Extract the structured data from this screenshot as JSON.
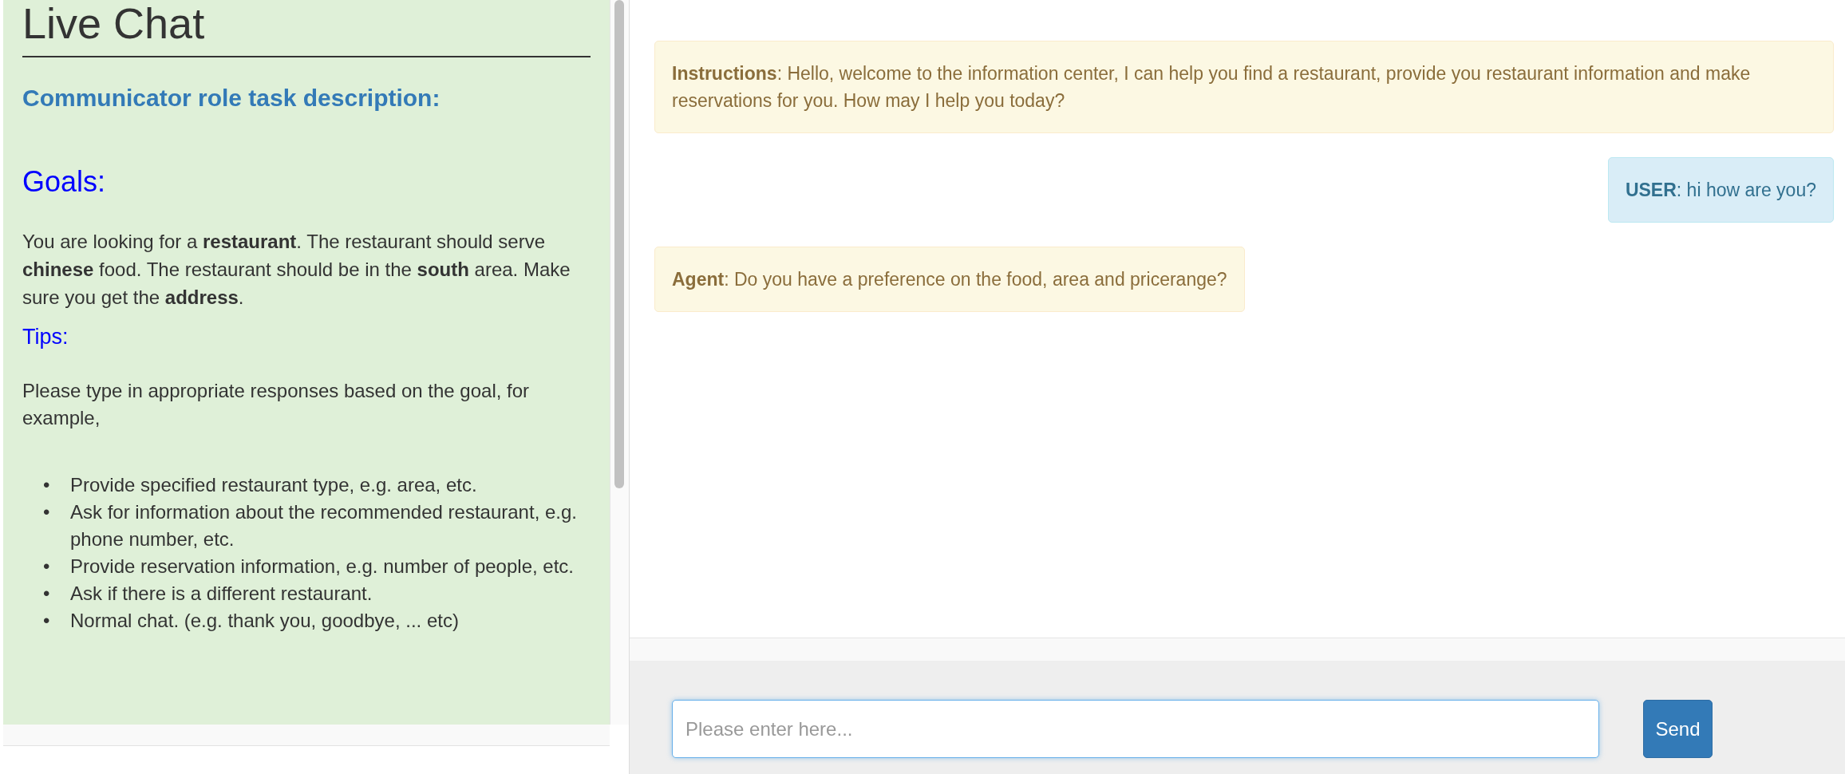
{
  "sidebar": {
    "title": "Live Chat",
    "subtitle": "Communicator role task description:",
    "goals_heading": "Goals:",
    "goal_text": "You are looking for a **restaurant**. The restaurant should serve **chinese** food. The restaurant should be in the **south** area. Make sure you get the **address**.",
    "tips_heading": "Tips:",
    "tips_intro": "Please type in appropriate responses based on the goal, for example,",
    "tips": [
      {
        "bullet": "•",
        "text": "Provide specified restaurant type, e.g. area, etc."
      },
      {
        "bullet": "•",
        "text": "Ask for information about the recommended restaurant, e.g. phone number, etc."
      },
      {
        "bullet": "•",
        "text": "Provide reservation information, e.g. number of people, etc."
      },
      {
        "bullet": "•",
        "text": "Ask if there is a different restaurant."
      },
      {
        "bullet": "•",
        "text": "Normal chat. (e.g. thank you, goodbye, ... etc)"
      }
    ]
  },
  "messages": [
    {
      "kind": "system",
      "text": "**Instructions**: Hello, welcome to the information center, I can help you find a restaurant, provide you restaurant information and make reservations for you. How may I help you today?"
    },
    {
      "kind": "user",
      "text": "**USER**: hi how are you?"
    },
    {
      "kind": "agent",
      "text": "**Agent**: Do you have a preference on the food, area and pricerange?"
    }
  ],
  "composer": {
    "placeholder": "Please enter here...",
    "send": "Send"
  }
}
